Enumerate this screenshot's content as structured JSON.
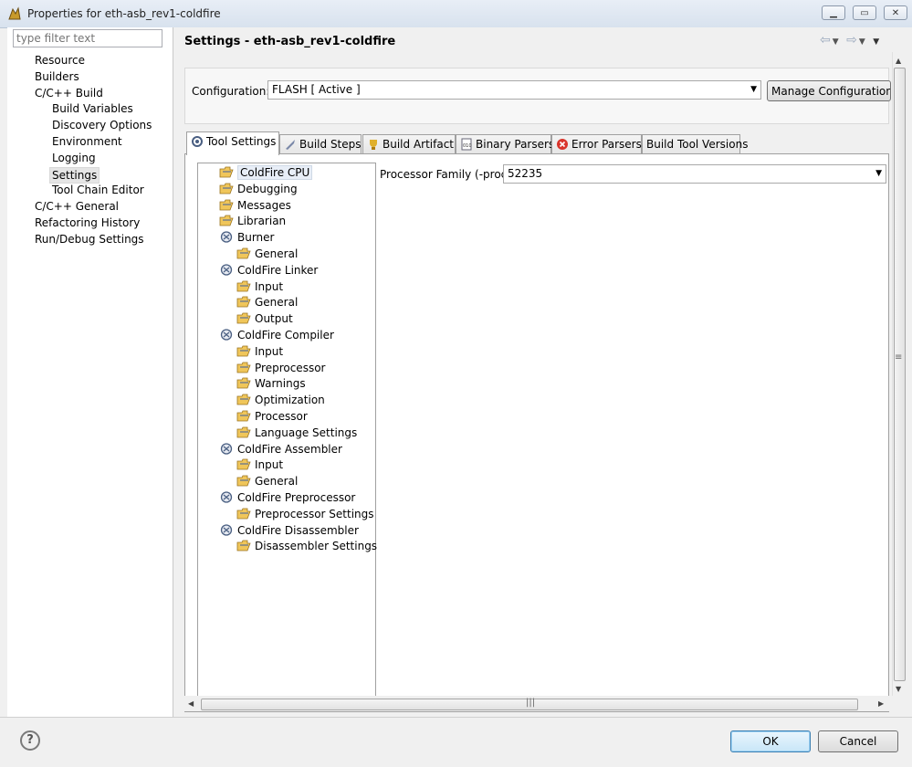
{
  "window": {
    "title": "Properties for eth-asb_rev1-coldfire",
    "minimize_icon": "minimize-icon",
    "maximize_icon": "maximize-icon",
    "close_icon": "close-icon"
  },
  "filter": {
    "placeholder": "type filter text"
  },
  "nav": {
    "items": [
      {
        "label": "Resource",
        "level": 0
      },
      {
        "label": "Builders",
        "level": 0
      },
      {
        "label": "C/C++ Build",
        "level": 0
      },
      {
        "label": "Build Variables",
        "level": 1
      },
      {
        "label": "Discovery Options",
        "level": 1
      },
      {
        "label": "Environment",
        "level": 1
      },
      {
        "label": "Logging",
        "level": 1
      },
      {
        "label": "Settings",
        "level": 1,
        "selected": true
      },
      {
        "label": "Tool Chain Editor",
        "level": 1
      },
      {
        "label": "C/C++ General",
        "level": 0
      },
      {
        "label": "Refactoring History",
        "level": 0
      },
      {
        "label": "Run/Debug Settings",
        "level": 0
      }
    ]
  },
  "page": {
    "title": "Settings - eth-asb_rev1-coldfire",
    "configuration_label": "Configuration:",
    "configuration_value": "FLASH  [ Active ]",
    "manage_button": "Manage Configurations..."
  },
  "tabs": [
    {
      "label": "Tool Settings",
      "icon": "tool-settings-icon",
      "active": true
    },
    {
      "label": "Build Steps",
      "icon": "build-steps-icon"
    },
    {
      "label": "Build Artifact",
      "icon": "build-artifact-icon"
    },
    {
      "label": "Binary Parsers",
      "icon": "binary-parsers-icon"
    },
    {
      "label": "Error Parsers",
      "icon": "error-parsers-icon"
    },
    {
      "label": "Build Tool Versions",
      "icon": ""
    }
  ],
  "tree": [
    {
      "label": "ColdFire CPU",
      "level": 0,
      "icon": "option-folder-icon",
      "selected": true
    },
    {
      "label": "Debugging",
      "level": 0,
      "icon": "option-folder-icon"
    },
    {
      "label": "Messages",
      "level": 0,
      "icon": "option-folder-icon"
    },
    {
      "label": "Librarian",
      "level": 0,
      "icon": "option-folder-icon"
    },
    {
      "label": "Burner",
      "level": 0,
      "icon": "tool-icon"
    },
    {
      "label": "General",
      "level": 1,
      "icon": "option-folder-icon"
    },
    {
      "label": "ColdFire Linker",
      "level": 0,
      "icon": "tool-icon"
    },
    {
      "label": "Input",
      "level": 1,
      "icon": "option-folder-icon"
    },
    {
      "label": "General",
      "level": 1,
      "icon": "option-folder-icon"
    },
    {
      "label": "Output",
      "level": 1,
      "icon": "option-folder-icon"
    },
    {
      "label": "ColdFire Compiler",
      "level": 0,
      "icon": "tool-icon"
    },
    {
      "label": "Input",
      "level": 1,
      "icon": "option-folder-icon"
    },
    {
      "label": "Preprocessor",
      "level": 1,
      "icon": "option-folder-icon"
    },
    {
      "label": "Warnings",
      "level": 1,
      "icon": "option-folder-icon"
    },
    {
      "label": "Optimization",
      "level": 1,
      "icon": "option-folder-icon"
    },
    {
      "label": "Processor",
      "level": 1,
      "icon": "option-folder-icon"
    },
    {
      "label": "Language Settings",
      "level": 1,
      "icon": "option-folder-icon"
    },
    {
      "label": "ColdFire Assembler",
      "level": 0,
      "icon": "tool-icon"
    },
    {
      "label": "Input",
      "level": 1,
      "icon": "option-folder-icon"
    },
    {
      "label": "General",
      "level": 1,
      "icon": "option-folder-icon"
    },
    {
      "label": "ColdFire Preprocessor",
      "level": 0,
      "icon": "tool-icon"
    },
    {
      "label": "Preprocessor Settings",
      "level": 1,
      "icon": "option-folder-icon"
    },
    {
      "label": "ColdFire Disassembler",
      "level": 0,
      "icon": "tool-icon"
    },
    {
      "label": "Disassembler Settings",
      "level": 1,
      "icon": "option-folder-icon"
    }
  ],
  "options": {
    "processor_family_label": "Processor Family (-proc)",
    "processor_family_value": "52235"
  },
  "buttons": {
    "ok": "OK",
    "cancel": "Cancel",
    "help": "?"
  },
  "colors": {
    "accent": "#3c7fb1",
    "selection": "#e8eef7"
  }
}
